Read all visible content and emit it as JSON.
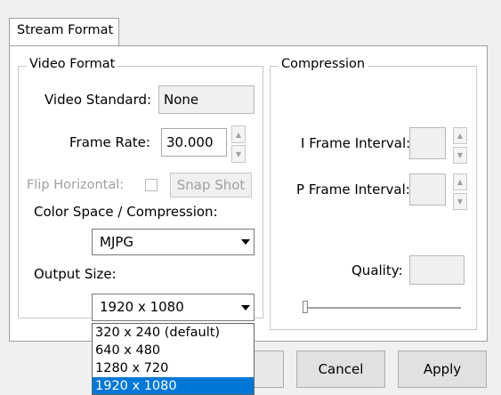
{
  "tab": {
    "label": "Stream Format"
  },
  "video_format": {
    "legend": "Video Format",
    "video_standard": {
      "label": "Video Standard:",
      "value": "None"
    },
    "frame_rate": {
      "label": "Frame Rate:",
      "value": "30.000"
    },
    "flip_horizontal": {
      "label": "Flip Horizontal:",
      "checked": false
    },
    "snap_shot_label": "Snap Shot",
    "color_space": {
      "label": "Color Space / Compression:",
      "value": "MJPG"
    },
    "output_size": {
      "label": "Output Size:",
      "value": "1920 x 1080",
      "options": [
        "320 x 240  (default)",
        "640 x 480",
        "1280 x 720",
        "1920 x 1080"
      ],
      "selected_index": 3
    }
  },
  "compression": {
    "legend": "Compression",
    "i_frame_interval": {
      "label": "I Frame Interval:",
      "value": ""
    },
    "p_frame_interval": {
      "label": "P Frame Interval:",
      "value": ""
    },
    "quality": {
      "label": "Quality:",
      "value": ""
    }
  },
  "buttons": {
    "cancel_label": "Cancel",
    "apply_label": "Apply"
  },
  "colors": {
    "selection": "#0078d7"
  }
}
